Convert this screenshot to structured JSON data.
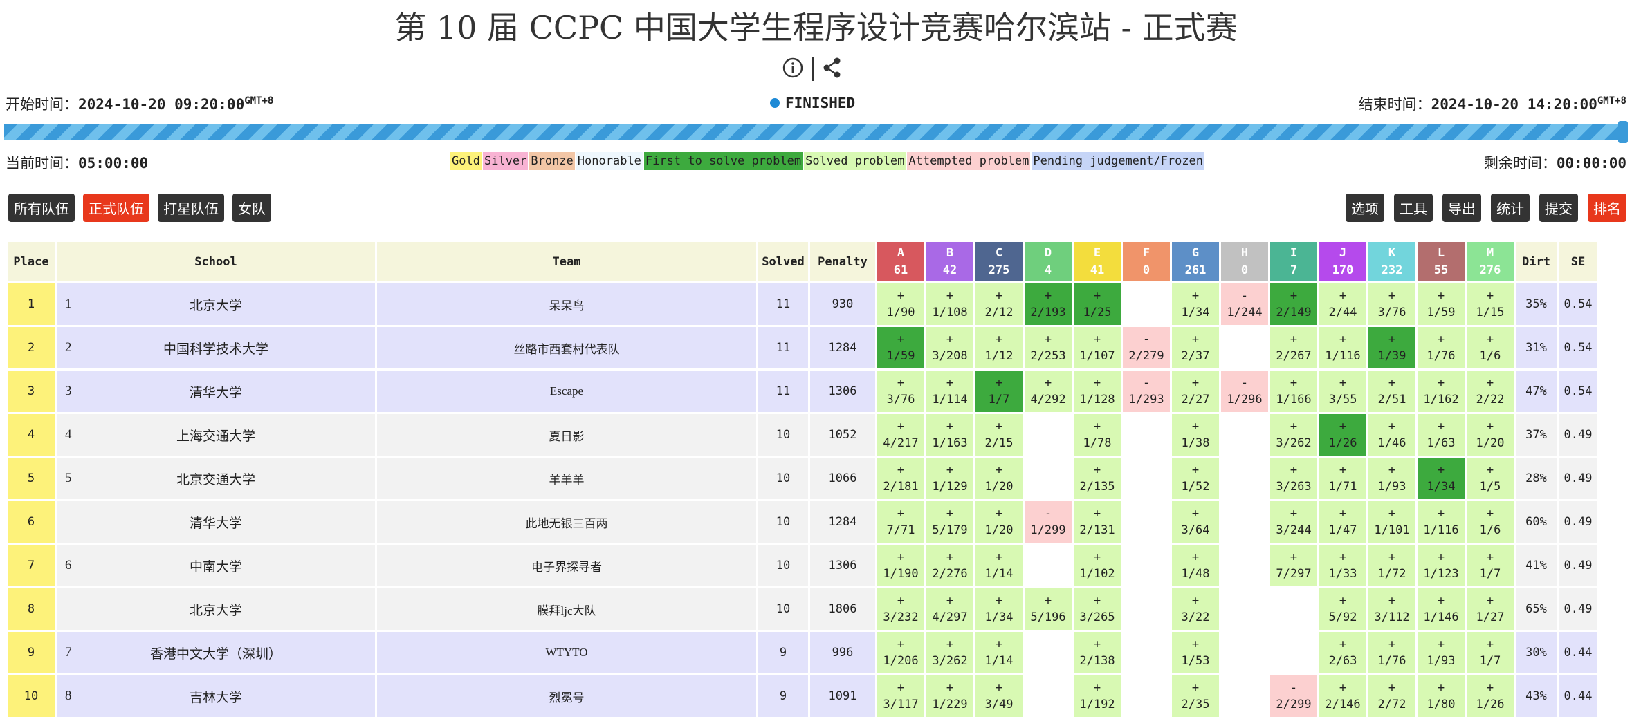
{
  "title": "第 10 届 CCPC 中国大学生程序设计竞赛哈尔滨站 - 正式赛",
  "start": {
    "label": "开始时间：",
    "value": "2024-10-20 09:20:00",
    "tz": "GMT+8"
  },
  "end": {
    "label": "结束时间：",
    "value": "2024-10-20 14:20:00",
    "tz": "GMT+8"
  },
  "status": "FINISHED",
  "current": {
    "label": "当前时间：",
    "value": "05:00:00"
  },
  "remaining": {
    "label": "剩余时间：",
    "value": "00:00:00"
  },
  "progress_percent": 100,
  "legend": [
    {
      "label": "Gold",
      "color": "#fdf27a"
    },
    {
      "label": "Silver",
      "color": "#f8b3d3"
    },
    {
      "label": "Bronze",
      "color": "#f2c6a6"
    },
    {
      "label": "Honorable",
      "color": "#eef7fd"
    },
    {
      "label": "First to solve problem",
      "color": "#3daa3e"
    },
    {
      "label": "Solved problem",
      "color": "#d8f9b3"
    },
    {
      "label": "Attempted problem",
      "color": "#fcd0d0"
    },
    {
      "label": "Pending judgement/Frozen",
      "color": "#c6d5f7"
    }
  ],
  "filters_left": [
    "所有队伍",
    "正式队伍",
    "打星队伍",
    "女队"
  ],
  "filters_left_active": 1,
  "filters_right": [
    "选项",
    "工具",
    "导出",
    "统计",
    "提交",
    "排名"
  ],
  "filters_right_active": 5,
  "headers": {
    "place": "Place",
    "school": "School",
    "team": "Team",
    "solved": "Solved",
    "penalty": "Penalty",
    "dirt": "Dirt",
    "se": "SE"
  },
  "problems": [
    {
      "id": "A",
      "count": "61",
      "color": "#d7585e"
    },
    {
      "id": "B",
      "count": "42",
      "color": "#a969e6"
    },
    {
      "id": "C",
      "count": "275",
      "color": "#4f6690"
    },
    {
      "id": "D",
      "count": "4",
      "color": "#6fcf7d"
    },
    {
      "id": "E",
      "count": "41",
      "color": "#f3dd3d"
    },
    {
      "id": "F",
      "count": "0",
      "color": "#f0946a"
    },
    {
      "id": "G",
      "count": "261",
      "color": "#5d8fc7"
    },
    {
      "id": "H",
      "count": "0",
      "color": "#c1c1c1"
    },
    {
      "id": "I",
      "count": "7",
      "color": "#4bb594"
    },
    {
      "id": "J",
      "count": "170",
      "color": "#b54aec"
    },
    {
      "id": "K",
      "count": "232",
      "color": "#72d5dc"
    },
    {
      "id": "L",
      "count": "55",
      "color": "#b36e6e"
    },
    {
      "id": "M",
      "count": "276",
      "color": "#8ce495"
    }
  ],
  "rows": [
    {
      "place": "1",
      "rank": "1",
      "school": "北京大学",
      "team": "呆呆鸟",
      "solved": "11",
      "penalty": "930",
      "dirt": "35%",
      "se": "0.54",
      "band": "blue",
      "cells": [
        [
          "ok",
          "+",
          "1/90"
        ],
        [
          "ok",
          "+",
          "1/108"
        ],
        [
          "ok",
          "+",
          "2/12"
        ],
        [
          "first",
          "+",
          "2/193"
        ],
        [
          "first",
          "+",
          "1/25"
        ],
        [
          "none",
          "",
          ""
        ],
        [
          "ok",
          "+",
          "1/34"
        ],
        [
          "wa",
          "-",
          "1/244"
        ],
        [
          "first",
          "+",
          "2/149"
        ],
        [
          "ok",
          "+",
          "2/44"
        ],
        [
          "ok",
          "+",
          "3/76"
        ],
        [
          "ok",
          "+",
          "1/59"
        ],
        [
          "ok",
          "+",
          "1/15"
        ]
      ]
    },
    {
      "place": "2",
      "rank": "2",
      "school": "中国科学技术大学",
      "team": "丝路市西套村代表队",
      "solved": "11",
      "penalty": "1284",
      "dirt": "31%",
      "se": "0.54",
      "band": "blue",
      "cells": [
        [
          "first",
          "+",
          "1/59"
        ],
        [
          "ok",
          "+",
          "3/208"
        ],
        [
          "ok",
          "+",
          "1/12"
        ],
        [
          "ok",
          "+",
          "2/253"
        ],
        [
          "ok",
          "+",
          "1/107"
        ],
        [
          "wa",
          "-",
          "2/279"
        ],
        [
          "ok",
          "+",
          "2/37"
        ],
        [
          "none",
          "",
          ""
        ],
        [
          "ok",
          "+",
          "2/267"
        ],
        [
          "ok",
          "+",
          "1/116"
        ],
        [
          "first",
          "+",
          "1/39"
        ],
        [
          "ok",
          "+",
          "1/76"
        ],
        [
          "ok",
          "+",
          "1/6"
        ]
      ]
    },
    {
      "place": "3",
      "rank": "3",
      "school": "清华大学",
      "team": "Escape",
      "solved": "11",
      "penalty": "1306",
      "dirt": "47%",
      "se": "0.54",
      "band": "blue",
      "cells": [
        [
          "ok",
          "+",
          "3/76"
        ],
        [
          "ok",
          "+",
          "1/114"
        ],
        [
          "first",
          "+",
          "1/7"
        ],
        [
          "ok",
          "+",
          "4/292"
        ],
        [
          "ok",
          "+",
          "1/128"
        ],
        [
          "wa",
          "-",
          "1/293"
        ],
        [
          "ok",
          "+",
          "2/27"
        ],
        [
          "wa",
          "-",
          "1/296"
        ],
        [
          "ok",
          "+",
          "1/166"
        ],
        [
          "ok",
          "+",
          "3/55"
        ],
        [
          "ok",
          "+",
          "2/51"
        ],
        [
          "ok",
          "+",
          "1/162"
        ],
        [
          "ok",
          "+",
          "2/22"
        ]
      ]
    },
    {
      "place": "4",
      "rank": "4",
      "school": "上海交通大学",
      "team": "夏日影",
      "solved": "10",
      "penalty": "1052",
      "dirt": "37%",
      "se": "0.49",
      "band": "grey",
      "cells": [
        [
          "ok",
          "+",
          "4/217"
        ],
        [
          "ok",
          "+",
          "1/163"
        ],
        [
          "ok",
          "+",
          "2/15"
        ],
        [
          "none",
          "",
          ""
        ],
        [
          "ok",
          "+",
          "1/78"
        ],
        [
          "none",
          "",
          ""
        ],
        [
          "ok",
          "+",
          "1/38"
        ],
        [
          "none",
          "",
          ""
        ],
        [
          "ok",
          "+",
          "3/262"
        ],
        [
          "first",
          "+",
          "1/26"
        ],
        [
          "ok",
          "+",
          "1/46"
        ],
        [
          "ok",
          "+",
          "1/63"
        ],
        [
          "ok",
          "+",
          "1/20"
        ]
      ]
    },
    {
      "place": "5",
      "rank": "5",
      "school": "北京交通大学",
      "team": "羊羊羊",
      "solved": "10",
      "penalty": "1066",
      "dirt": "28%",
      "se": "0.49",
      "band": "grey",
      "cells": [
        [
          "ok",
          "+",
          "2/181"
        ],
        [
          "ok",
          "+",
          "1/129"
        ],
        [
          "ok",
          "+",
          "1/20"
        ],
        [
          "none",
          "",
          ""
        ],
        [
          "ok",
          "+",
          "2/135"
        ],
        [
          "none",
          "",
          ""
        ],
        [
          "ok",
          "+",
          "1/52"
        ],
        [
          "none",
          "",
          ""
        ],
        [
          "ok",
          "+",
          "3/263"
        ],
        [
          "ok",
          "+",
          "1/71"
        ],
        [
          "ok",
          "+",
          "1/93"
        ],
        [
          "first",
          "+",
          "1/34"
        ],
        [
          "ok",
          "+",
          "1/5"
        ]
      ]
    },
    {
      "place": "6",
      "rank": "",
      "school": "清华大学",
      "team": "此地无银三百两",
      "solved": "10",
      "penalty": "1284",
      "dirt": "60%",
      "se": "0.49",
      "band": "grey",
      "cells": [
        [
          "ok",
          "+",
          "7/71"
        ],
        [
          "ok",
          "+",
          "5/179"
        ],
        [
          "ok",
          "+",
          "1/20"
        ],
        [
          "wa",
          "-",
          "1/299"
        ],
        [
          "ok",
          "+",
          "2/131"
        ],
        [
          "none",
          "",
          ""
        ],
        [
          "ok",
          "+",
          "3/64"
        ],
        [
          "none",
          "",
          ""
        ],
        [
          "ok",
          "+",
          "3/244"
        ],
        [
          "ok",
          "+",
          "1/47"
        ],
        [
          "ok",
          "+",
          "1/101"
        ],
        [
          "ok",
          "+",
          "1/116"
        ],
        [
          "ok",
          "+",
          "1/6"
        ]
      ]
    },
    {
      "place": "7",
      "rank": "6",
      "school": "中南大学",
      "team": "电子界探寻者",
      "solved": "10",
      "penalty": "1306",
      "dirt": "41%",
      "se": "0.49",
      "band": "grey",
      "cells": [
        [
          "ok",
          "+",
          "1/190"
        ],
        [
          "ok",
          "+",
          "2/276"
        ],
        [
          "ok",
          "+",
          "1/14"
        ],
        [
          "none",
          "",
          ""
        ],
        [
          "ok",
          "+",
          "1/102"
        ],
        [
          "none",
          "",
          ""
        ],
        [
          "ok",
          "+",
          "1/48"
        ],
        [
          "none",
          "",
          ""
        ],
        [
          "ok",
          "+",
          "7/297"
        ],
        [
          "ok",
          "+",
          "1/33"
        ],
        [
          "ok",
          "+",
          "1/72"
        ],
        [
          "ok",
          "+",
          "1/123"
        ],
        [
          "ok",
          "+",
          "1/7"
        ]
      ]
    },
    {
      "place": "8",
      "rank": "",
      "school": "北京大学",
      "team": "膜拜ljc大队",
      "solved": "10",
      "penalty": "1806",
      "dirt": "65%",
      "se": "0.49",
      "band": "grey",
      "cells": [
        [
          "ok",
          "+",
          "3/232"
        ],
        [
          "ok",
          "+",
          "4/297"
        ],
        [
          "ok",
          "+",
          "1/34"
        ],
        [
          "ok",
          "+",
          "5/196"
        ],
        [
          "ok",
          "+",
          "3/265"
        ],
        [
          "none",
          "",
          ""
        ],
        [
          "ok",
          "+",
          "3/22"
        ],
        [
          "none",
          "",
          ""
        ],
        [
          "none",
          "",
          ""
        ],
        [
          "ok",
          "+",
          "5/92"
        ],
        [
          "ok",
          "+",
          "3/112"
        ],
        [
          "ok",
          "+",
          "1/146"
        ],
        [
          "ok",
          "+",
          "1/27"
        ]
      ]
    },
    {
      "place": "9",
      "rank": "7",
      "school": "香港中文大学（深圳）",
      "team": "WTYTO",
      "solved": "9",
      "penalty": "996",
      "dirt": "30%",
      "se": "0.44",
      "band": "blue",
      "cells": [
        [
          "ok",
          "+",
          "1/206"
        ],
        [
          "ok",
          "+",
          "3/262"
        ],
        [
          "ok",
          "+",
          "1/14"
        ],
        [
          "none",
          "",
          ""
        ],
        [
          "ok",
          "+",
          "2/138"
        ],
        [
          "none",
          "",
          ""
        ],
        [
          "ok",
          "+",
          "1/53"
        ],
        [
          "none",
          "",
          ""
        ],
        [
          "none",
          "",
          ""
        ],
        [
          "ok",
          "+",
          "2/63"
        ],
        [
          "ok",
          "+",
          "1/76"
        ],
        [
          "ok",
          "+",
          "1/93"
        ],
        [
          "ok",
          "+",
          "1/7"
        ]
      ]
    },
    {
      "place": "10",
      "rank": "8",
      "school": "吉林大学",
      "team": "烈冕号",
      "solved": "9",
      "penalty": "1091",
      "dirt": "43%",
      "se": "0.44",
      "band": "blue",
      "cells": [
        [
          "ok",
          "+",
          "3/117"
        ],
        [
          "ok",
          "+",
          "1/229"
        ],
        [
          "ok",
          "+",
          "3/49"
        ],
        [
          "none",
          "",
          ""
        ],
        [
          "ok",
          "+",
          "1/192"
        ],
        [
          "none",
          "",
          ""
        ],
        [
          "ok",
          "+",
          "2/35"
        ],
        [
          "none",
          "",
          ""
        ],
        [
          "wa",
          "-",
          "2/299"
        ],
        [
          "ok",
          "+",
          "2/146"
        ],
        [
          "ok",
          "+",
          "2/72"
        ],
        [
          "ok",
          "+",
          "1/80"
        ],
        [
          "ok",
          "+",
          "1/26"
        ]
      ]
    }
  ]
}
